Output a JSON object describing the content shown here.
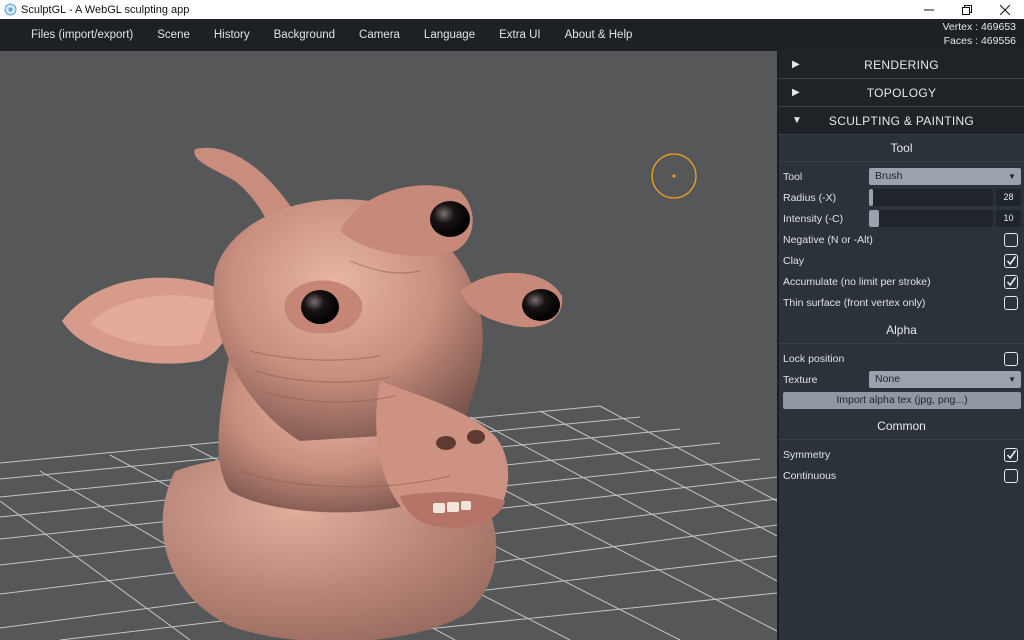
{
  "window": {
    "title": "SculptGL - A WebGL sculpting app"
  },
  "menu": {
    "items": [
      "Files (import/export)",
      "Scene",
      "History",
      "Background",
      "Camera",
      "Language",
      "Extra UI",
      "About & Help"
    ],
    "stats": {
      "vertex": "Vertex : 469653",
      "faces": "Faces : 469556"
    }
  },
  "panel": {
    "sections": [
      {
        "label": "RENDERING",
        "arrow": "▶"
      },
      {
        "label": "TOPOLOGY",
        "arrow": "▶"
      },
      {
        "label": "SCULPTING & PAINTING",
        "arrow": "▼"
      }
    ],
    "tool": {
      "header": "Tool",
      "tool_label": "Tool",
      "tool_value": "Brush",
      "radius_label": "Radius (-X)",
      "radius_value": "28",
      "radius_fraction": 0.03,
      "intensity_label": "Intensity (-C)",
      "intensity_value": "10",
      "intensity_fraction": 0.08,
      "negative_label": "Negative (N or -Alt)",
      "negative_checked": false,
      "clay_label": "Clay",
      "clay_checked": true,
      "accumulate_label": "Accumulate (no limit per stroke)",
      "accumulate_checked": true,
      "thin_label": "Thin surface (front vertex only)",
      "thin_checked": false
    },
    "alpha": {
      "header": "Alpha",
      "lock_label": "Lock position",
      "lock_checked": false,
      "texture_label": "Texture",
      "texture_value": "None",
      "import_button": "Import alpha tex (jpg, png...)"
    },
    "common": {
      "header": "Common",
      "symmetry_label": "Symmetry",
      "symmetry_checked": true,
      "continuous_label": "Continuous",
      "continuous_checked": false
    }
  },
  "colors": {
    "viewport_bg": "#555759",
    "panel_bg": "#2b323a",
    "brush_cursor": "#f0a020"
  }
}
